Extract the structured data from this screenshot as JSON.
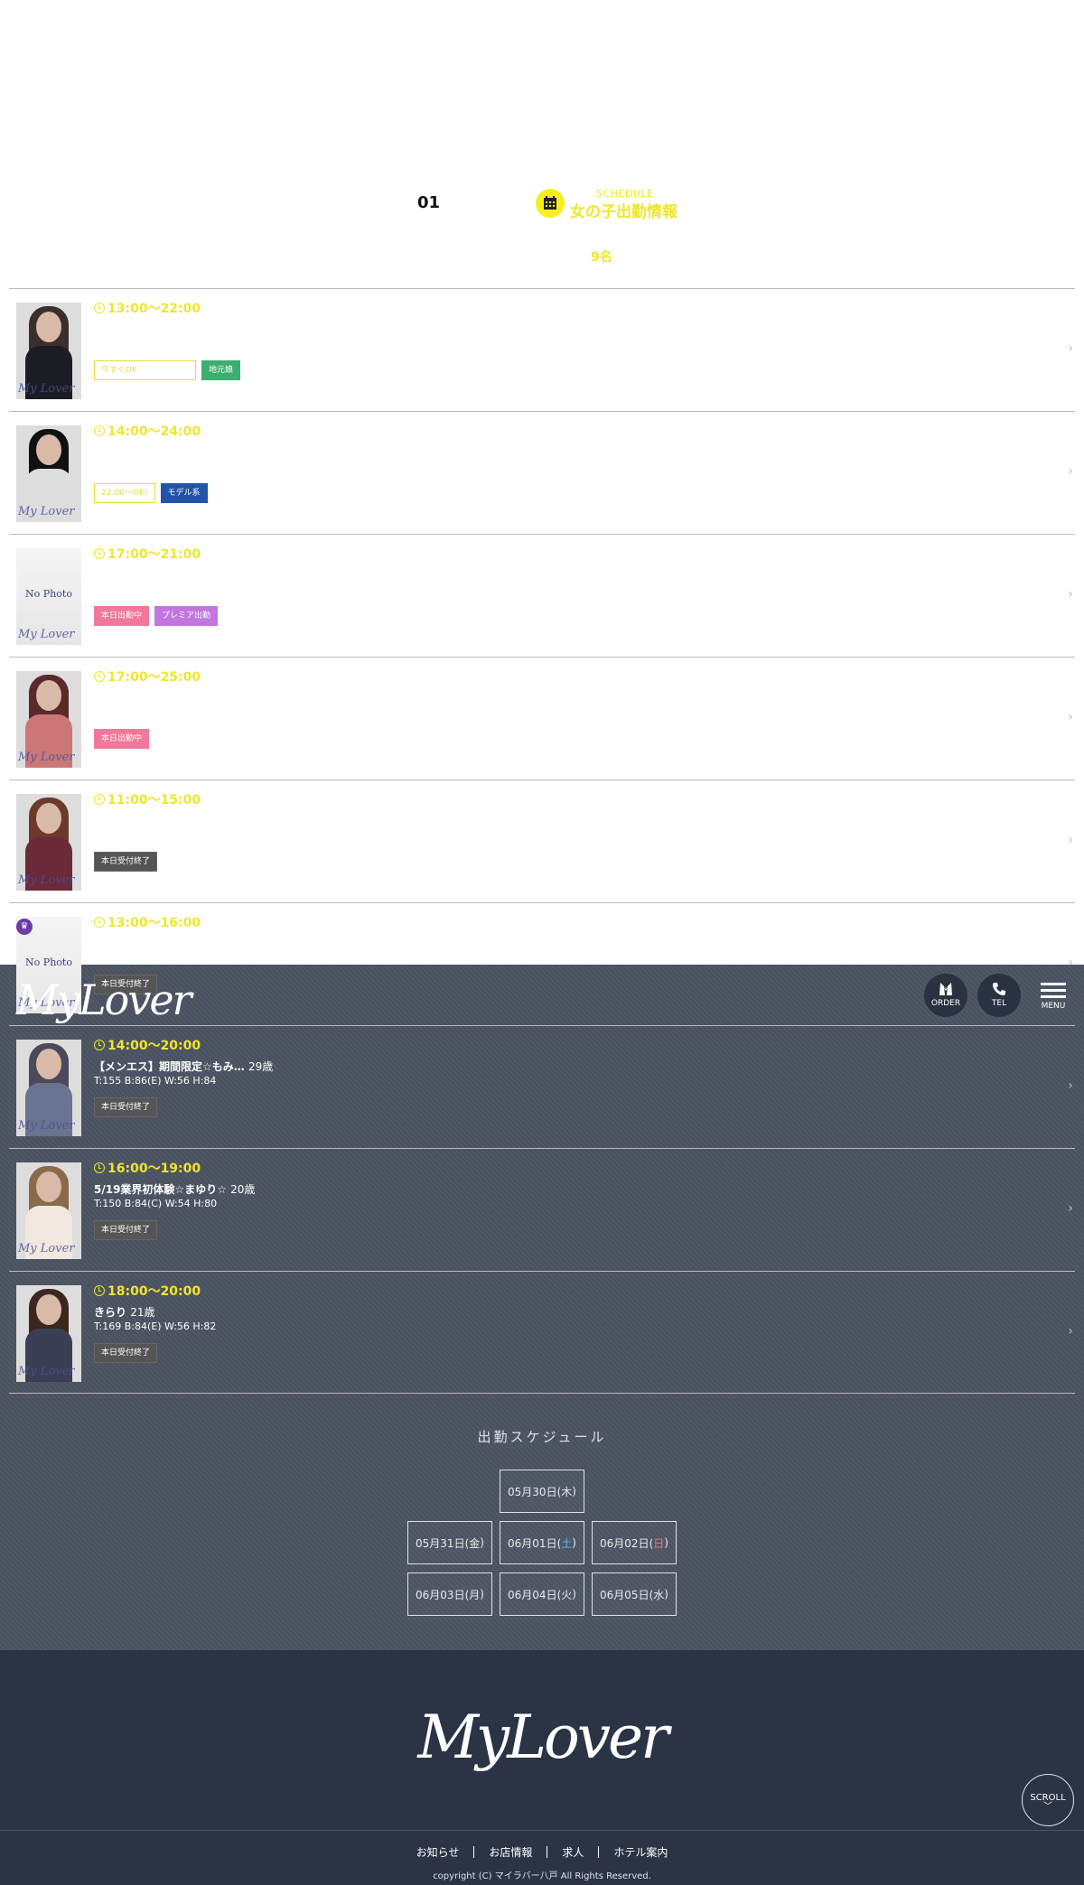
{
  "header": {
    "page_number": "01",
    "schedule_en": "SCHEDULE",
    "schedule_jp": "女の子出勤情報",
    "count": "9名"
  },
  "girls": [
    {
      "time": "13:00〜22:00",
      "name": "",
      "age": "",
      "stats": "",
      "tags": [
        "今すぐOK",
        "地元娘"
      ],
      "photo": "photo"
    },
    {
      "time": "14:00〜24:00",
      "name": "",
      "age": "",
      "stats": "",
      "tags": [
        "22:00〜OK!",
        "モデル系"
      ],
      "photo": "photo"
    },
    {
      "time": "17:00〜21:00",
      "name": "",
      "age": "",
      "stats": "",
      "tags": [
        "本日出勤中",
        "プレミア出勤"
      ],
      "photo": "nophoto"
    },
    {
      "time": "17:00〜25:00",
      "name": "",
      "age": "",
      "stats": "",
      "tags": [
        "本日出勤中"
      ],
      "photo": "photo"
    },
    {
      "time": "11:00〜15:00",
      "name": "",
      "age": "",
      "stats": "",
      "tags": [
        "本日受付終了"
      ],
      "photo": "photo"
    },
    {
      "time": "13:00〜16:00",
      "name": "",
      "age": "",
      "stats": "",
      "tags": [
        "本日受付終了"
      ],
      "photo": "nophoto"
    },
    {
      "time": "14:00〜20:00",
      "name": "【メンエス】期間限定☆もみ…",
      "age": "29歳",
      "stats": "T:155 B:86(E) W:56 H:84",
      "tags": [
        "本日受付終了"
      ],
      "photo": "photo"
    },
    {
      "time": "16:00〜19:00",
      "name": "5/19業界初体験☆まゆり☆",
      "age": "20歳",
      "stats": "T:150 B:84(C) W:54 H:80",
      "tags": [
        "本日受付終了"
      ],
      "photo": "photo"
    },
    {
      "time": "18:00〜20:00",
      "name": "きらり",
      "age": "21歳",
      "stats": "T:169 B:84(E) W:56 H:82",
      "tags": [
        "本日受付終了"
      ],
      "photo": "photo"
    }
  ],
  "topbar": {
    "logo": "MyLover",
    "order_label": "ORDER",
    "tel_label": "TEL",
    "menu_label": "MENU"
  },
  "schedule": {
    "title": "出勤スケジュール",
    "dates": [
      {
        "pre": "05月30日(",
        "day": "木",
        "post": ")",
        "kind": ""
      },
      {
        "pre": "05月31日(",
        "day": "金",
        "post": ")",
        "kind": ""
      },
      {
        "pre": "06月01日(",
        "day": "土",
        "post": ")",
        "kind": "sat"
      },
      {
        "pre": "06月02日(",
        "day": "日",
        "post": ")",
        "kind": "sun"
      },
      {
        "pre": "06月03日(",
        "day": "月",
        "post": ")",
        "kind": ""
      },
      {
        "pre": "06月04日(",
        "day": "火",
        "post": ")",
        "kind": ""
      },
      {
        "pre": "06月05日(",
        "day": "水",
        "post": ")",
        "kind": ""
      }
    ]
  },
  "footer": {
    "logo": "MyLover",
    "nav": [
      "お知らせ",
      "お店情報",
      "求人",
      "ホテル案内"
    ],
    "copyright": "copyright (C) マイラバー八戸 All Rights Reserved.",
    "scroll_label": "SCROLL"
  },
  "colors": {
    "accent": "#f0e62a",
    "dark_bg": "#4a5261",
    "footer_bg": "#2a3445"
  }
}
